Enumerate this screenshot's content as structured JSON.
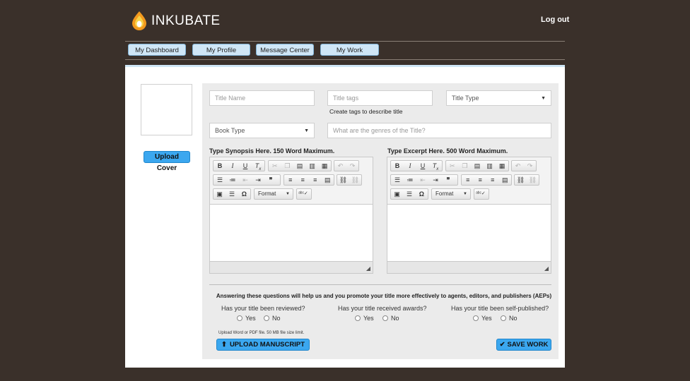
{
  "header": {
    "logo_text": "INKUBATE",
    "logout_label": "Log out"
  },
  "nav": {
    "items": [
      "My Dashboard",
      "My Profile",
      "Message Center",
      "My Work"
    ]
  },
  "cover": {
    "upload_label": "Upload Cover"
  },
  "form": {
    "title_name_placeholder": "Title Name",
    "title_tags_placeholder": "Title tags",
    "title_tags_hint": "Create tags to describe title",
    "title_type_value": "Title Type",
    "book_type_value": "Book Type",
    "genres_placeholder": "What are the genres of the Title?"
  },
  "editors": {
    "synopsis_label": "Type Synopsis Here. 150 Word Maximum.",
    "excerpt_label": "Type Excerpt Here. 500 Word Maximum.",
    "format_label": "Format"
  },
  "questions": {
    "intro": "Answering these questions will help us and you promote your title more effectively to agents, editors, and publishers (AEPs)",
    "items": [
      {
        "text": "Has your title been reviewed?",
        "yes": "Yes",
        "no": "No"
      },
      {
        "text": "Has your title received awards?",
        "yes": "Yes",
        "no": "No"
      },
      {
        "text": "Has your title been self-published?",
        "yes": "Yes",
        "no": "No"
      }
    ]
  },
  "upload": {
    "note": "Upload Word or PDF file. 50 MB file size limit.",
    "manuscript_label": "UPLOAD MANUSCRIPT",
    "save_label": "SAVE WORK"
  },
  "colors": {
    "background": "#3a302a",
    "accent": "#3ba7ef",
    "nav_button": "#cfe6f6"
  }
}
